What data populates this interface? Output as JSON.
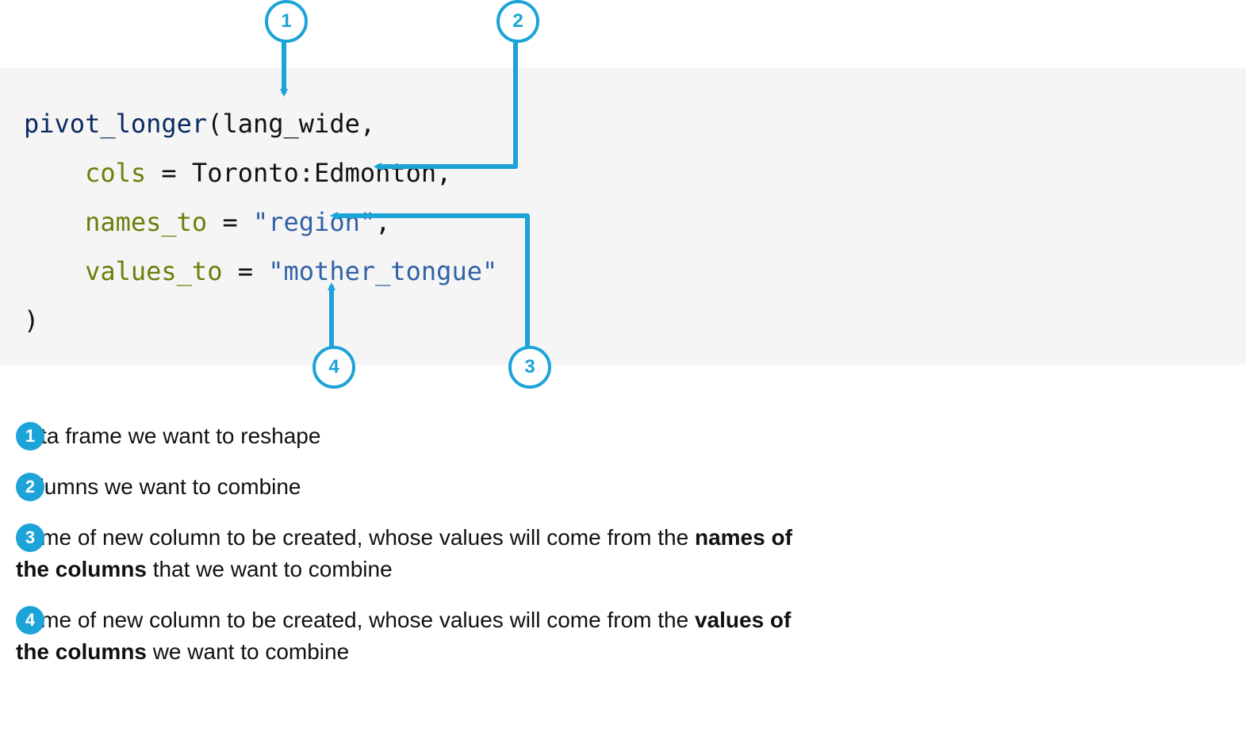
{
  "code": {
    "fn": "pivot_longer",
    "open": "(",
    "df": "lang_wide",
    "comma": ",",
    "indent": "    ",
    "cols_kw": "cols",
    "eq": " = ",
    "cols_val": "Toronto:Edmonton",
    "names_kw": "names_to",
    "names_val": "\"region\"",
    "values_kw": "values_to",
    "values_val": "\"mother_tongue\"",
    "close": ")"
  },
  "badges": {
    "b1": "1",
    "b2": "2",
    "b3": "3",
    "b4": "4"
  },
  "legend": {
    "i1": "data frame we want to reshape",
    "i2": "columns we want to combine",
    "i3a": "name of new column to be created, whose values will come from the ",
    "i3b": "names of the columns",
    "i3c": " that we want to combine",
    "i4a": "name of new column to be created, whose values will come from the ",
    "i4b": "values of the columns",
    "i4c": " we want to combine"
  },
  "colors": {
    "accent": "#1ca3d8"
  }
}
